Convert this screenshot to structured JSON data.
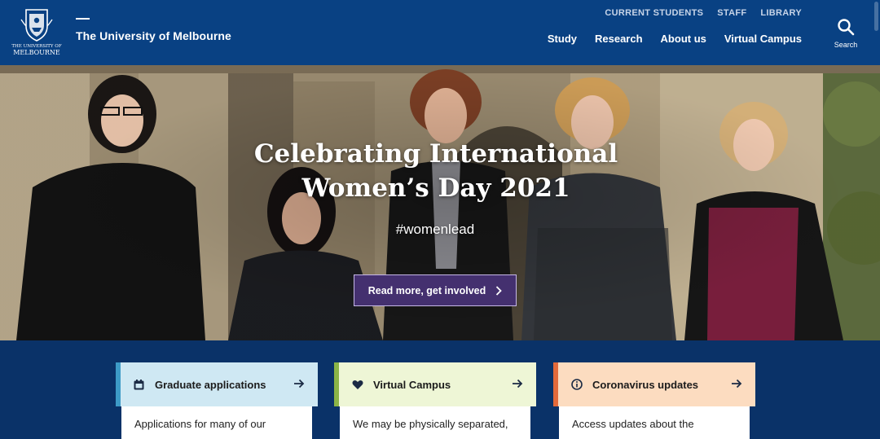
{
  "header": {
    "logo_text_top": "THE UNIVERSITY OF",
    "logo_text_bottom": "MELBOURNE",
    "site_title": "The University of Melbourne",
    "util_nav": [
      "CURRENT STUDENTS",
      "STAFF",
      "LIBRARY"
    ],
    "main_nav": [
      "Study",
      "Research",
      "About us",
      "Virtual Campus"
    ],
    "search_label": "Search"
  },
  "hero": {
    "title_line1": "Celebrating International",
    "title_line2": "Women’s Day 2021",
    "tag": "#womenlead",
    "cta_label": "Read more, get involved",
    "cta_icon": "chevron-right-icon"
  },
  "cards": [
    {
      "title": "Graduate applications",
      "icon": "calendar-icon",
      "body": "Applications for many of our",
      "head_color": "#cfe8f3",
      "accent_color": "#3d9bc7"
    },
    {
      "title": "Virtual Campus",
      "icon": "heart-icon",
      "body": "We may be physically separated,",
      "head_color": "#eef6d6",
      "accent_color": "#8bb447"
    },
    {
      "title": "Coronavirus updates",
      "icon": "info-icon",
      "body": "Access updates about the",
      "head_color": "#fcdcc0",
      "accent_color": "#e46a3a"
    }
  ],
  "colors": {
    "header_bg": "#094183",
    "section_bg": "#0a3268",
    "cta_bg": "#44306f"
  }
}
